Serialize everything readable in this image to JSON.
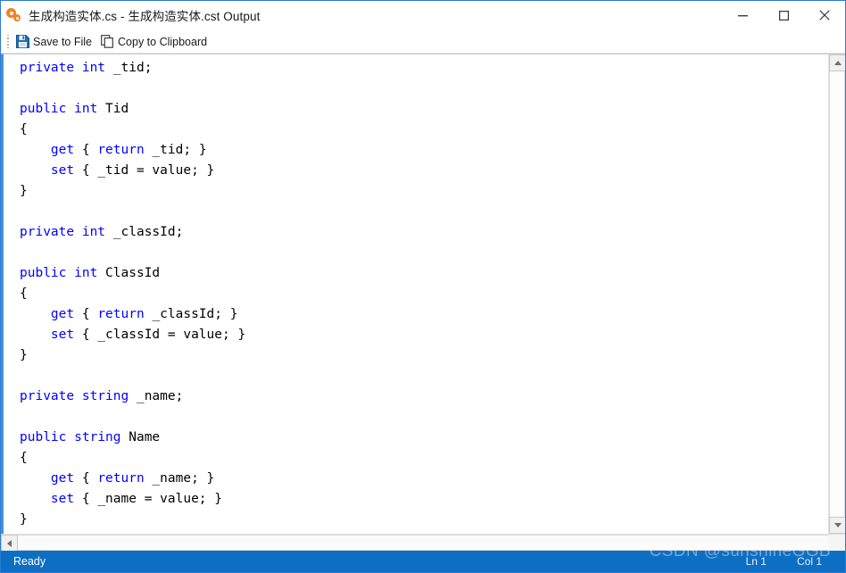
{
  "window": {
    "title": "生成构造实体.cs - 生成构造实体.cst Output",
    "icon": "gear-icon",
    "controls": {
      "minimize": "Minimize",
      "maximize": "Maximize",
      "close": "Close"
    }
  },
  "toolbar": {
    "save_label": "Save to File",
    "copy_label": "Copy to Clipboard",
    "save_icon": "floppy-disk-icon",
    "copy_icon": "copy-icon"
  },
  "editor": {
    "language": "csharp",
    "lines": [
      [
        {
          "t": "private",
          "k": true
        },
        {
          "t": " "
        },
        {
          "t": "int",
          "k": true
        },
        {
          "t": " _tid;"
        }
      ],
      [],
      [
        {
          "t": "public",
          "k": true
        },
        {
          "t": " "
        },
        {
          "t": "int",
          "k": true
        },
        {
          "t": " Tid"
        }
      ],
      [
        {
          "t": "{"
        }
      ],
      [
        {
          "t": "    "
        },
        {
          "t": "get",
          "k": true
        },
        {
          "t": " { "
        },
        {
          "t": "return",
          "k": true
        },
        {
          "t": " _tid; }"
        }
      ],
      [
        {
          "t": "    "
        },
        {
          "t": "set",
          "k": true
        },
        {
          "t": " { _tid = value; }"
        }
      ],
      [
        {
          "t": "}"
        }
      ],
      [],
      [
        {
          "t": "private",
          "k": true
        },
        {
          "t": " "
        },
        {
          "t": "int",
          "k": true
        },
        {
          "t": " _classId;"
        }
      ],
      [],
      [
        {
          "t": "public",
          "k": true
        },
        {
          "t": " "
        },
        {
          "t": "int",
          "k": true
        },
        {
          "t": " ClassId"
        }
      ],
      [
        {
          "t": "{"
        }
      ],
      [
        {
          "t": "    "
        },
        {
          "t": "get",
          "k": true
        },
        {
          "t": " { "
        },
        {
          "t": "return",
          "k": true
        },
        {
          "t": " _classId; }"
        }
      ],
      [
        {
          "t": "    "
        },
        {
          "t": "set",
          "k": true
        },
        {
          "t": " { _classId = value; }"
        }
      ],
      [
        {
          "t": "}"
        }
      ],
      [],
      [
        {
          "t": "private",
          "k": true
        },
        {
          "t": " "
        },
        {
          "t": "string",
          "k": true
        },
        {
          "t": " _name;"
        }
      ],
      [],
      [
        {
          "t": "public",
          "k": true
        },
        {
          "t": " "
        },
        {
          "t": "string",
          "k": true
        },
        {
          "t": " Name"
        }
      ],
      [
        {
          "t": "{"
        }
      ],
      [
        {
          "t": "    "
        },
        {
          "t": "get",
          "k": true
        },
        {
          "t": " { "
        },
        {
          "t": "return",
          "k": true
        },
        {
          "t": " _name; }"
        }
      ],
      [
        {
          "t": "    "
        },
        {
          "t": "set",
          "k": true
        },
        {
          "t": " { _name = value; }"
        }
      ],
      [
        {
          "t": "}"
        }
      ]
    ]
  },
  "scrollbars": {
    "v_up_icon": "scroll-up-arrow-icon",
    "v_down_icon": "scroll-down-arrow-icon",
    "h_left_icon": "scroll-left-arrow-icon"
  },
  "statusbar": {
    "status": "Ready",
    "line": "Ln 1",
    "column": "Col 1"
  },
  "watermark": {
    "text": "CSDN @sunshineGGB"
  },
  "colors": {
    "accent": "#0d6fc4",
    "keyword": "#0000ff",
    "code_text": "#000000",
    "titlebar_bg": "#ffffff",
    "editor_border": "#4a8fd4",
    "icon_orange": "#ef8321",
    "save_icon_blue": "#1a6fb5"
  }
}
